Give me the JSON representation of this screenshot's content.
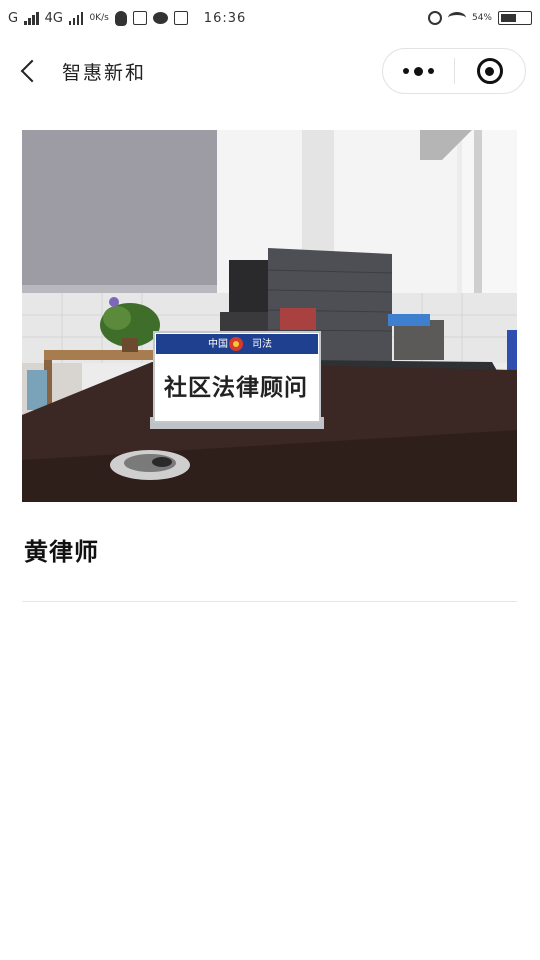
{
  "status_bar": {
    "carrier1": "G",
    "carrier2": "4G",
    "net_speed": "0K/s",
    "time": "16:36",
    "battery_pct": "54%",
    "battery_level": 0.54
  },
  "nav": {
    "title": "智惠新和"
  },
  "photo": {
    "sign_header_left": "中国",
    "sign_header_right": "司法",
    "sign_text": "社区法律顾问"
  },
  "lawyer": {
    "name": "黄律师"
  },
  "colors": {
    "sign_blue": "#1f3f8f",
    "desk": "#3a2622"
  }
}
